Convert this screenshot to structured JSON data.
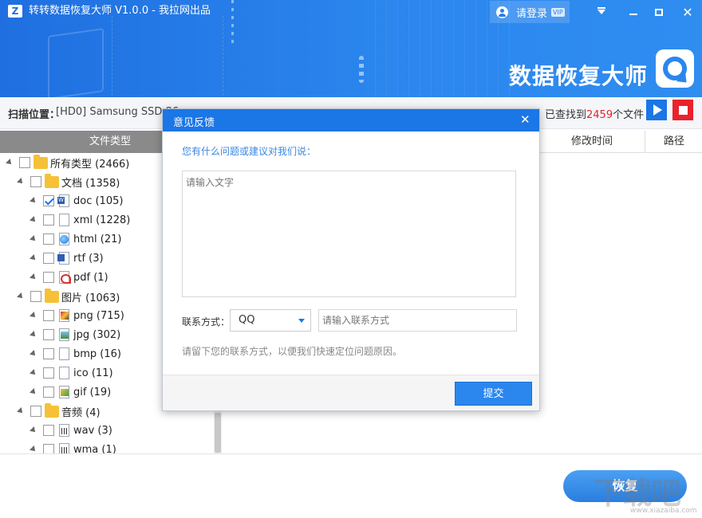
{
  "window": {
    "title": "转转数据恢复大师 V1.0.0 - 我拉网出品",
    "logo_letter": "Z",
    "login_label": "请登录",
    "vip_badge": "VIP",
    "close_glyph": "✕"
  },
  "banner": {
    "brand_text": "数据恢复大师"
  },
  "scan_bar": {
    "location_label": "扫描位置：",
    "location_value": "[HD0] Samsung SSD 86",
    "found_prefix": "已查找到",
    "found_count": "2459",
    "found_suffix": "个文件"
  },
  "tree": {
    "header": "文件类型",
    "items": [
      {
        "label": "所有类型 (2466)",
        "icon": "folder-icon",
        "checked": false
      },
      {
        "label": "文档 (1358)",
        "icon": "folder-icon",
        "checked": false
      },
      {
        "label": "doc (105)",
        "icon": "doc-file-icon",
        "checked": true
      },
      {
        "label": "xml (1228)",
        "icon": "xml-file-icon",
        "checked": false
      },
      {
        "label": "html (21)",
        "icon": "html-file-icon",
        "checked": false
      },
      {
        "label": "rtf (3)",
        "icon": "rtf-file-icon",
        "checked": false
      },
      {
        "label": "pdf (1)",
        "icon": "pdf-file-icon",
        "checked": false
      },
      {
        "label": "图片 (1063)",
        "icon": "folder-icon",
        "checked": false
      },
      {
        "label": "png (715)",
        "icon": "png-file-icon",
        "checked": false
      },
      {
        "label": "jpg (302)",
        "icon": "jpg-file-icon",
        "checked": false
      },
      {
        "label": "bmp (16)",
        "icon": "bmp-file-icon",
        "checked": false
      },
      {
        "label": "ico (11)",
        "icon": "ico-file-icon",
        "checked": false
      },
      {
        "label": "gif (19)",
        "icon": "gif-file-icon",
        "checked": false
      },
      {
        "label": "音频 (4)",
        "icon": "folder-icon",
        "checked": false
      },
      {
        "label": "wav (3)",
        "icon": "wav-file-icon",
        "checked": false
      },
      {
        "label": "wma (1)",
        "icon": "wma-file-icon",
        "checked": false
      }
    ]
  },
  "list": {
    "columns": [
      "修改时间",
      "路径"
    ]
  },
  "bottom": {
    "recover_label": "恢复",
    "watermark": "下载吧",
    "watermark_url": "www.xiazaiba.com"
  },
  "dialog": {
    "title": "意见反馈",
    "close_glyph": "✕",
    "prompt": "您有什么问题或建议对我们说：",
    "feedback_placeholder": "请输入文字",
    "contact_label": "联系方式：",
    "contact_selected": "QQ",
    "contact_placeholder": "请输入联系方式",
    "hint": "请留下您的联系方式，以便我们快速定位问题原因。",
    "submit_label": "提交"
  },
  "colors": {
    "primary_blue": "#1b76e6",
    "stop_red": "#e8232b",
    "count_red": "#e8232b"
  }
}
